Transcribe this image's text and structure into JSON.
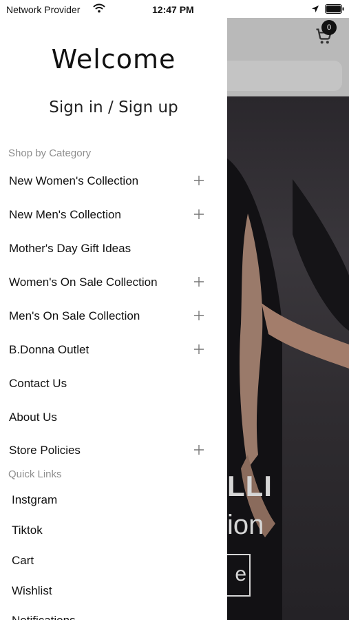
{
  "status_bar": {
    "carrier": "Network Provider",
    "time": "12:47 PM"
  },
  "drawer": {
    "welcome": "Welcome",
    "sign_in": "Sign in / Sign up",
    "shop_by_category_title": "Shop by Category",
    "categories": [
      {
        "label": "New Women's Collection",
        "expandable": true
      },
      {
        "label": "New Men's Collection",
        "expandable": true
      },
      {
        "label": "Mother's Day Gift Ideas",
        "expandable": false
      },
      {
        "label": "Women's On Sale Collection",
        "expandable": true
      },
      {
        "label": "Men's On Sale Collection",
        "expandable": true
      },
      {
        "label": "B.Donna Outlet",
        "expandable": true
      },
      {
        "label": "Contact Us",
        "expandable": false
      },
      {
        "label": "About Us",
        "expandable": false
      },
      {
        "label": "Store Policies",
        "expandable": true
      }
    ],
    "quick_links_title": "Quick Links",
    "quick_links": [
      "Instgram",
      "Tiktok",
      "Cart",
      "Wishlist",
      "Notifications"
    ]
  },
  "background": {
    "cart_count": "0",
    "hero_line1": "LLI",
    "hero_line2": "ion",
    "hero_button": "e"
  }
}
